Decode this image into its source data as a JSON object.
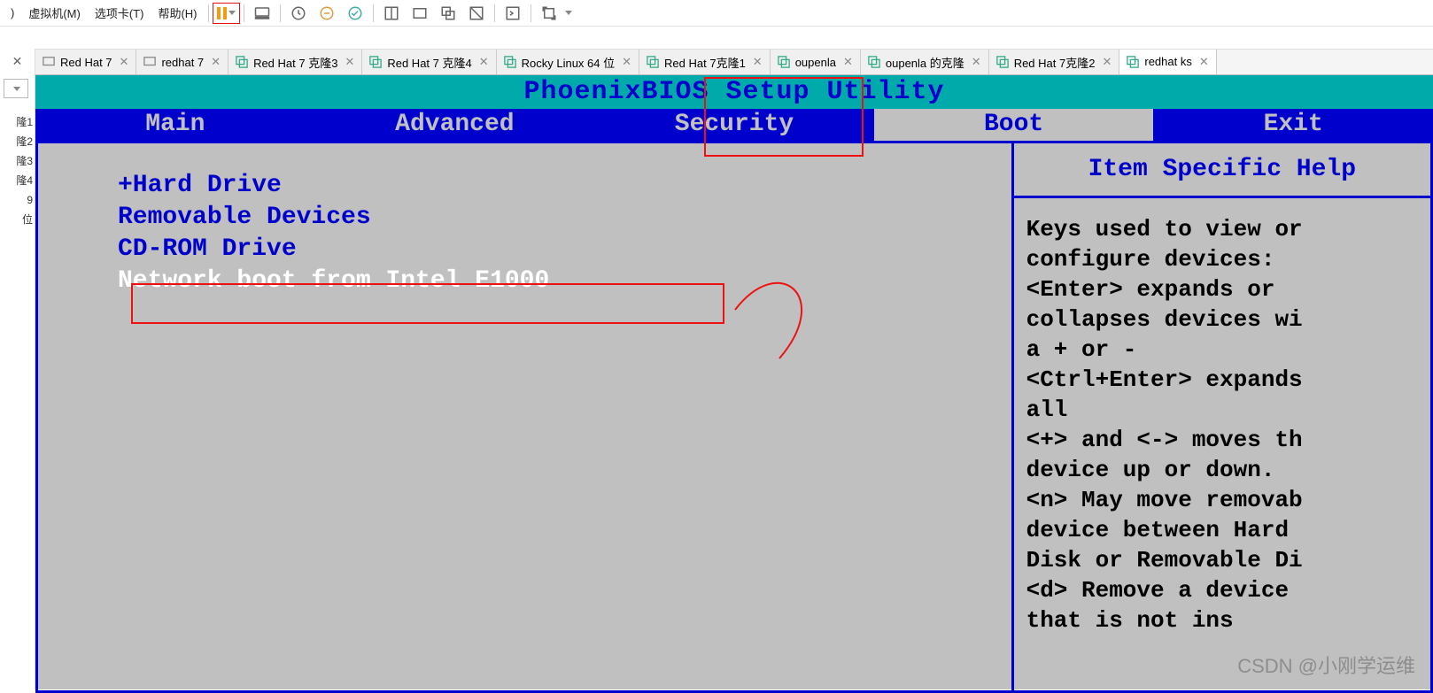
{
  "menubar": {
    "items": [
      "虚拟机(M)",
      "选项卡(T)",
      "帮助(H)"
    ]
  },
  "sidebar": {
    "tree": [
      "隆1",
      "隆2",
      "隆3",
      "隆4",
      "9",
      "位"
    ]
  },
  "tabs": [
    {
      "label": "Red Hat 7",
      "type": "single"
    },
    {
      "label": "redhat 7",
      "type": "single"
    },
    {
      "label": "Red Hat 7 克隆3",
      "type": "multi"
    },
    {
      "label": "Red Hat 7 克隆4",
      "type": "multi"
    },
    {
      "label": "Rocky Linux 64 位",
      "type": "multi"
    },
    {
      "label": "Red Hat 7克隆1",
      "type": "multi"
    },
    {
      "label": "oupenla",
      "type": "multi"
    },
    {
      "label": "oupenla 的克隆",
      "type": "multi"
    },
    {
      "label": "Red Hat 7克隆2",
      "type": "multi"
    },
    {
      "label": "redhat ks",
      "type": "multi",
      "active": true
    }
  ],
  "bios": {
    "title": "PhoenixBIOS Setup Utility",
    "menu": [
      "Main",
      "Advanced",
      "Security",
      "Boot",
      "Exit"
    ],
    "selected_menu": "Boot",
    "boot_order": [
      {
        "text": "+Hard Drive",
        "selected": false
      },
      {
        "text": " Removable Devices",
        "selected": false
      },
      {
        "text": " CD-ROM Drive",
        "selected": false
      },
      {
        "text": " Network boot from Intel E1000",
        "selected": true
      }
    ],
    "help_title": "Item Specific Help",
    "help_body": "Keys used to view or\nconfigure devices:\n<Enter> expands or\ncollapses devices wi\na + or -\n<Ctrl+Enter> expands\nall\n<+> and <-> moves th\ndevice up or down.\n<n> May move removab\ndevice between Hard\nDisk or Removable Di\n<d> Remove a device\nthat is not ins"
  },
  "watermark": "CSDN @小刚学运维"
}
